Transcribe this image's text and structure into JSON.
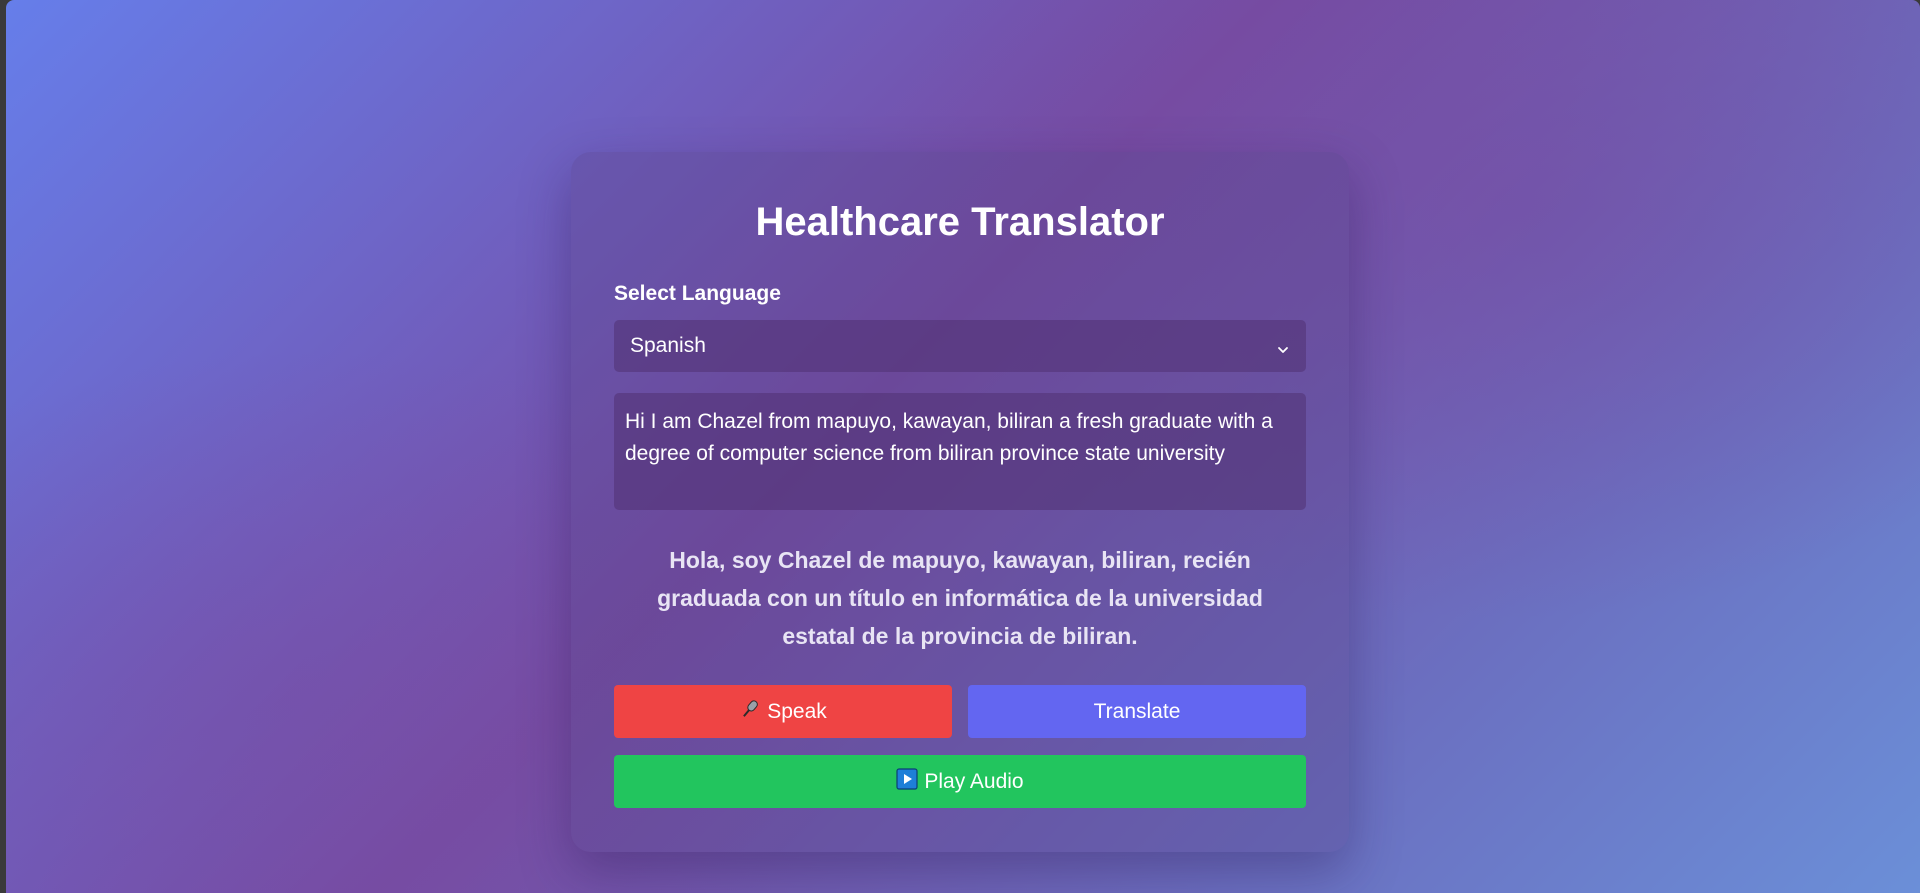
{
  "app": {
    "title": "Healthcare Translator"
  },
  "language": {
    "label": "Select Language",
    "selected": "Spanish"
  },
  "input": {
    "value": "Hi I am Chazel from mapuyo, kawayan, biliran a fresh graduate with a degree of computer science from biliran province state university"
  },
  "output": {
    "translation": "Hola, soy Chazel de mapuyo, kawayan, biliran, recién graduada con un título en informática de la universidad estatal de la provincia de biliran."
  },
  "buttons": {
    "speak_label": "Speak",
    "speak_icon": "microphone-icon",
    "translate_label": "Translate",
    "play_label": "Play Audio",
    "play_icon": "play-icon"
  },
  "colors": {
    "speak": "#ef4444",
    "translate": "#6366f1",
    "play": "#22c55e",
    "background_start": "#667eea",
    "background_end": "#764ba2"
  }
}
